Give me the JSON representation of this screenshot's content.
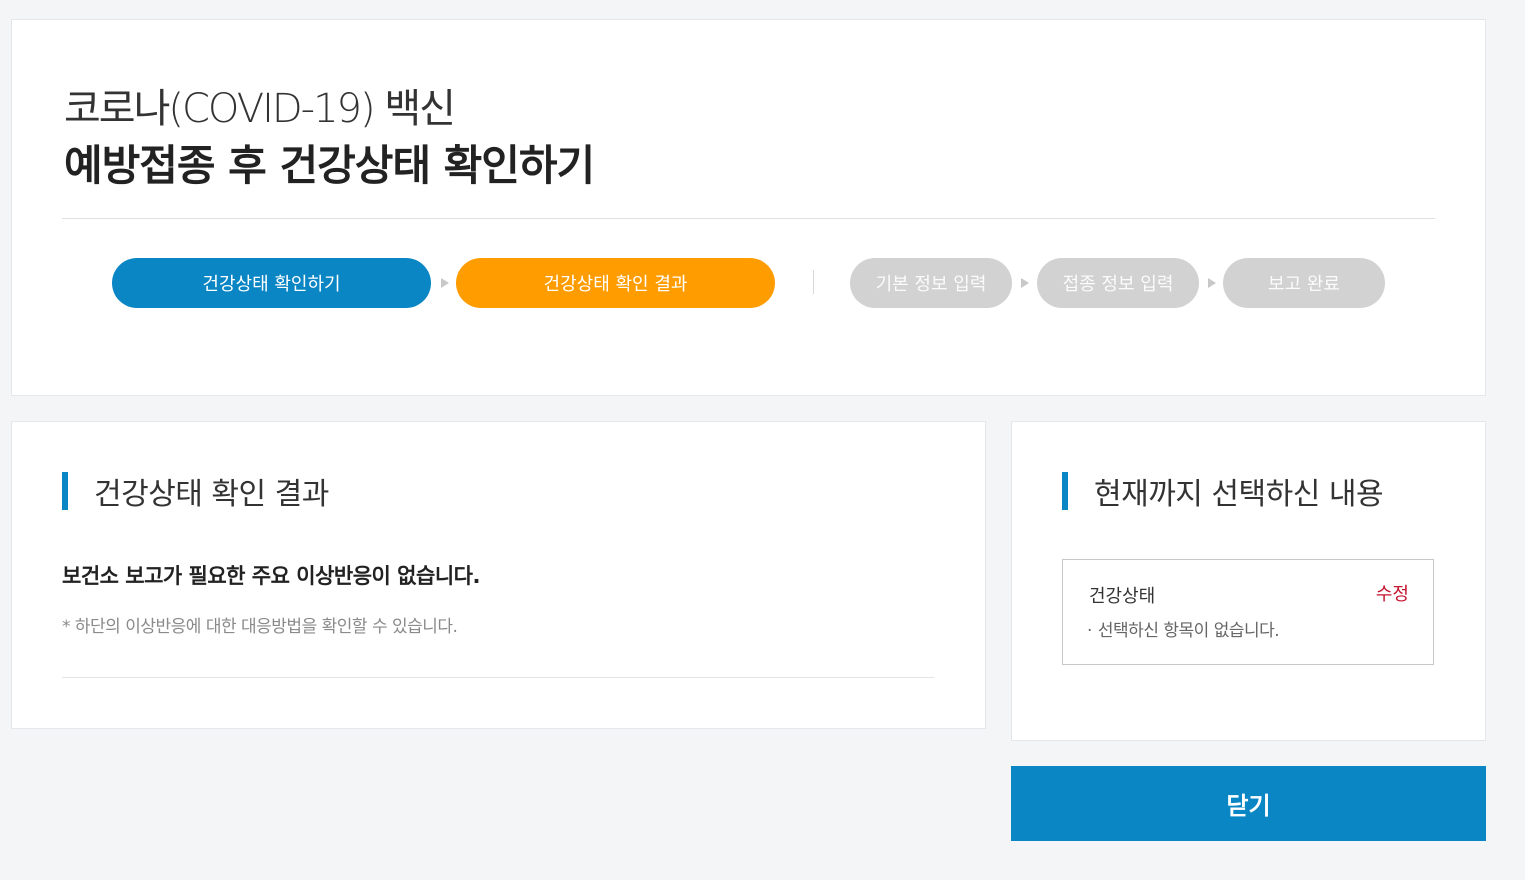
{
  "header": {
    "title_line1": "코로나(COVID-19) 백신",
    "title_line2": "예방접종 후 건강상태 확인하기"
  },
  "steps": [
    {
      "label": "건강상태 확인하기",
      "state": "done"
    },
    {
      "label": "건강상태 확인 결과",
      "state": "current"
    },
    {
      "label": "기본 정보 입력",
      "state": "todo"
    },
    {
      "label": "접종 정보 입력",
      "state": "todo"
    },
    {
      "label": "보고 완료",
      "state": "todo"
    }
  ],
  "result": {
    "section_title": "건강상태 확인 결과",
    "message": "보건소 보고가 필요한 주요 이상반응이 없습니다.",
    "note": "* 하단의 이상반응에 대한 대응방법을 확인할 수 있습니다."
  },
  "summary": {
    "section_title": "현재까지 선택하신 내용",
    "item_label": "건강상태",
    "edit_label": "수정",
    "item_bullet": "·",
    "item_value": "선택하신 항목이 없습니다."
  },
  "actions": {
    "close_label": "닫기"
  },
  "colors": {
    "primary": "#0b86c4",
    "current_step": "#ff9c00",
    "inactive_step": "#d2d2d2",
    "edit_link": "#c5152f"
  }
}
